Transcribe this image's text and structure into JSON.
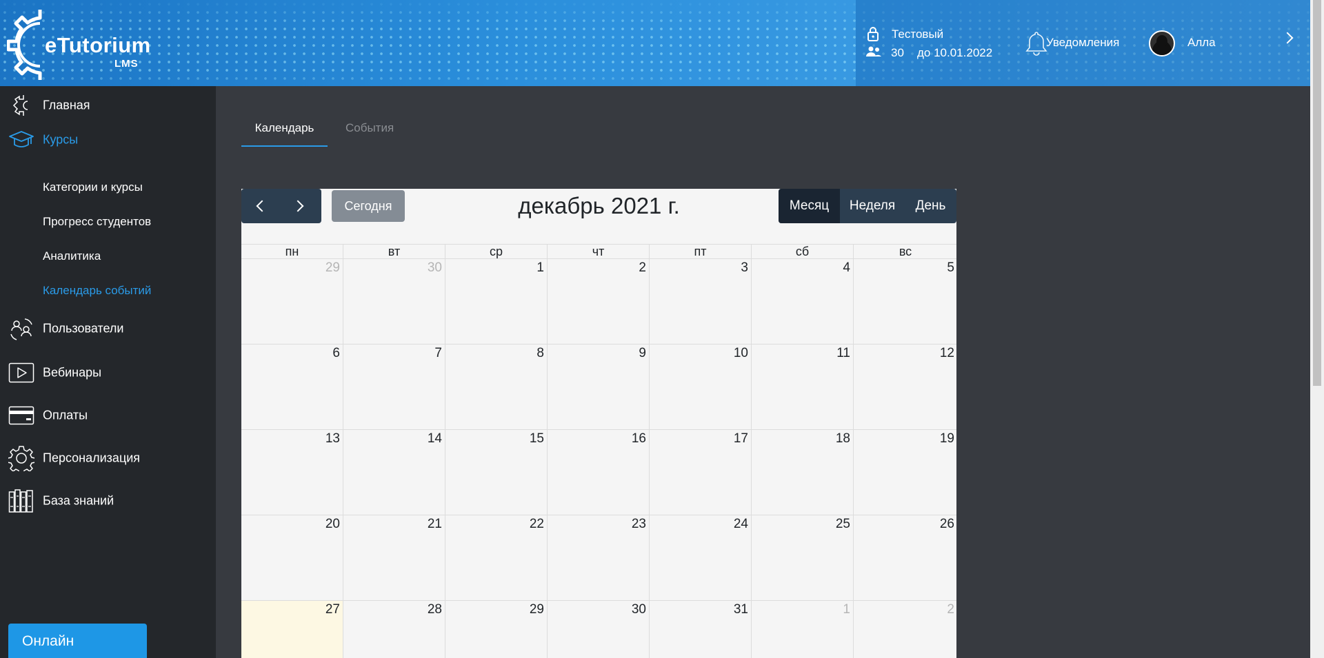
{
  "header": {
    "logo": {
      "name": "eTutorium",
      "sub": "LMS"
    },
    "account": {
      "plan": "Тестовый",
      "users_count": "30",
      "valid_until": "до 10.01.2022",
      "notifications_label": "Уведомления",
      "user_name": "Алла"
    }
  },
  "sidebar": {
    "items": [
      {
        "label": "Главная",
        "icon": "home-icon"
      },
      {
        "label": "Курсы",
        "icon": "graduation-cap-icon",
        "active": true
      },
      {
        "label": "Пользователи",
        "icon": "users-cycle-icon"
      },
      {
        "label": "Вебинары",
        "icon": "play-icon"
      },
      {
        "label": "Оплаты",
        "icon": "card-icon"
      },
      {
        "label": "Персонализация",
        "icon": "gear-icon"
      },
      {
        "label": "База знаний",
        "icon": "books-icon"
      }
    ],
    "subitems": [
      {
        "label": "Категории и курсы"
      },
      {
        "label": "Прогресс студентов"
      },
      {
        "label": "Аналитика"
      },
      {
        "label": "Календарь событий",
        "active": true
      }
    ],
    "online_label": "Онлайн"
  },
  "tabs": [
    {
      "label": "Календарь",
      "active": true
    },
    {
      "label": "События",
      "active": false
    }
  ],
  "calendar": {
    "title": "декабрь 2021 г.",
    "today_label": "Сегодня",
    "views": [
      {
        "label": "Месяц",
        "active": true
      },
      {
        "label": "Неделя",
        "active": false
      },
      {
        "label": "День",
        "active": false
      }
    ],
    "weekdays": [
      "пн",
      "вт",
      "ср",
      "чт",
      "пт",
      "сб",
      "вс"
    ],
    "weeks": [
      [
        {
          "d": "29",
          "other": true
        },
        {
          "d": "30",
          "other": true
        },
        {
          "d": "1"
        },
        {
          "d": "2"
        },
        {
          "d": "3"
        },
        {
          "d": "4"
        },
        {
          "d": "5"
        }
      ],
      [
        {
          "d": "6"
        },
        {
          "d": "7"
        },
        {
          "d": "8"
        },
        {
          "d": "9"
        },
        {
          "d": "10"
        },
        {
          "d": "11"
        },
        {
          "d": "12"
        }
      ],
      [
        {
          "d": "13"
        },
        {
          "d": "14"
        },
        {
          "d": "15"
        },
        {
          "d": "16"
        },
        {
          "d": "17"
        },
        {
          "d": "18"
        },
        {
          "d": "19"
        }
      ],
      [
        {
          "d": "20"
        },
        {
          "d": "21"
        },
        {
          "d": "22"
        },
        {
          "d": "23"
        },
        {
          "d": "24"
        },
        {
          "d": "25"
        },
        {
          "d": "26"
        }
      ],
      [
        {
          "d": "27",
          "today": true
        },
        {
          "d": "28"
        },
        {
          "d": "29"
        },
        {
          "d": "30"
        },
        {
          "d": "31"
        },
        {
          "d": "1",
          "other": true
        },
        {
          "d": "2",
          "other": true
        }
      ]
    ]
  },
  "colors": {
    "accent": "#2a9be8",
    "sidebar_bg": "#24272b",
    "main_bg": "#373a40",
    "calendar_bg": "#f5f5f5",
    "today_bg": "#fdf8e3",
    "toolbar_btn": "#2c3e50"
  }
}
